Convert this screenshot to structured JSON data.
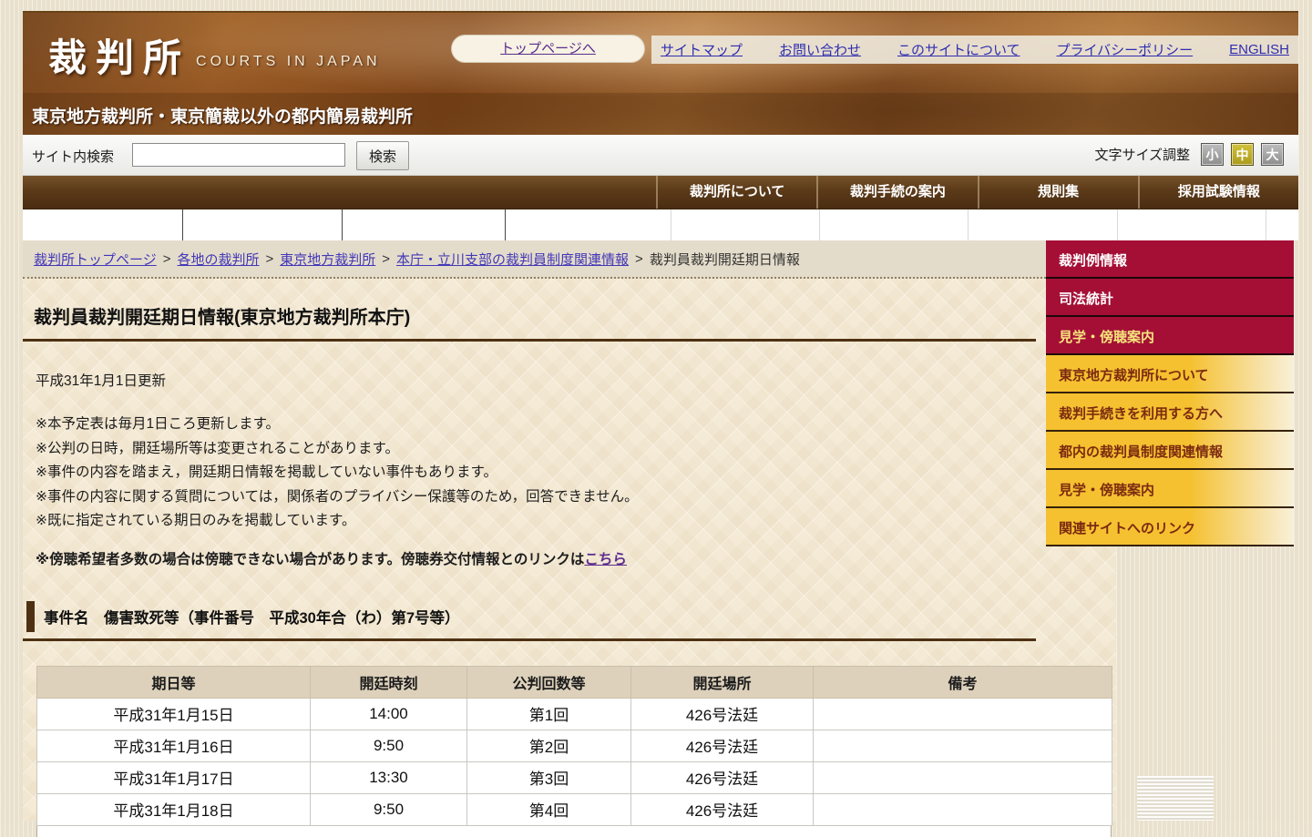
{
  "header": {
    "logo_jp": "裁判所",
    "logo_en": "COURTS IN JAPAN",
    "top_button": "トップページへ",
    "top_links": [
      "サイトマップ",
      "お問い合わせ",
      "このサイトについて",
      "プライバシーポリシー",
      "ENGLISH"
    ],
    "subtitle": "東京地方裁判所・東京簡裁以外の都内簡易裁判所"
  },
  "toolbar": {
    "search_label": "サイト内検索",
    "search_value": "",
    "search_button": "検索",
    "font_size_label": "文字サイズ調整",
    "font_sizes": [
      {
        "label": "小",
        "cls": "sz-gray"
      },
      {
        "label": "中",
        "cls": "sz-active"
      },
      {
        "label": "大",
        "cls": "sz-gray"
      }
    ]
  },
  "nav": {
    "items": [
      "裁判所について",
      "裁判手続の案内",
      "規則集",
      "採用試験情報"
    ]
  },
  "breadcrumb": {
    "links": [
      "裁判所トップページ",
      "各地の裁判所",
      "東京地方裁判所",
      "本庁・立川支部の裁判員制度関連情報"
    ],
    "separator": ">",
    "current": "裁判員裁判開廷期日情報"
  },
  "sidebar": {
    "items": [
      {
        "label": "裁判例情報",
        "cls": "crimson"
      },
      {
        "label": "司法統計",
        "cls": "crimson"
      },
      {
        "label": "見学・傍聴案内",
        "cls": "crimson active"
      },
      {
        "label": "東京地方裁判所について",
        "cls": "gold"
      },
      {
        "label": "裁判手続きを利用する方へ",
        "cls": "gold"
      },
      {
        "label": "都内の裁判員制度関連情報",
        "cls": "gold"
      },
      {
        "label": "見学・傍聴案内",
        "cls": "gold"
      },
      {
        "label": "関連サイトへのリンク",
        "cls": "gold"
      }
    ]
  },
  "main": {
    "title": "裁判員裁判開廷期日情報(東京地方裁判所本庁)",
    "updated": "平成31年1月1日更新",
    "notes": [
      "※本予定表は毎月1日ころ更新します。",
      "※公判の日時，開廷場所等は変更されることがあります。",
      "※事件の内容を踏まえ，開廷期日情報を掲載していない事件もあります。",
      "※事件の内容に関する質問については，関係者のプライバシー保護等のため，回答できません。",
      "※既に指定されている期日のみを掲載しています。"
    ],
    "bold_note_prefix": "※傍聴希望者多数の場合は傍聴できない場合があります。傍聴券交付情報とのリンクは",
    "bold_note_link": "こちら",
    "case_title": "事件名　傷害致死等（事件番号　平成30年合（わ）第7号等）",
    "table": {
      "headers": [
        "期日等",
        "開廷時刻",
        "公判回数等",
        "開廷場所",
        "備考"
      ],
      "rows": [
        {
          "date": "平成31年1月15日",
          "time": "14:00",
          "session": "第1回",
          "room": "426号法廷",
          "note": ""
        },
        {
          "date": "平成31年1月16日",
          "time": "9:50",
          "session": "第2回",
          "room": "426号法廷",
          "note": ""
        },
        {
          "date": "平成31年1月17日",
          "time": "13:30",
          "session": "第3回",
          "room": "426号法廷",
          "note": ""
        },
        {
          "date": "平成31年1月18日",
          "time": "9:50",
          "session": "第4回",
          "room": "426号法廷",
          "note": ""
        }
      ]
    }
  },
  "colors": {
    "accent_crimson": "#a50f36",
    "accent_gold": "#f5c130",
    "nav_brown": "#5b3a18",
    "rule_brown": "#4e3113",
    "link_blue": "#2e2eb0",
    "link_purple": "#5b2d8e",
    "active_item_text": "#f6e57c"
  }
}
